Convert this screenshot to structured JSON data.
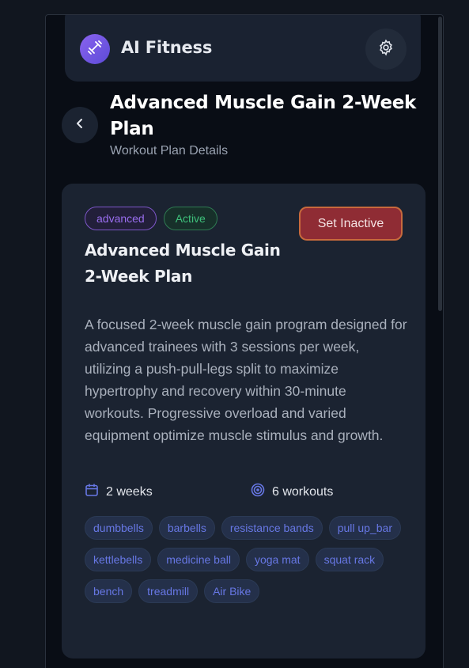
{
  "app": {
    "title": "AI Fitness"
  },
  "header": {
    "title": "Advanced Muscle Gain 2-Week Plan",
    "subtitle": "Workout Plan Details"
  },
  "plan": {
    "level_badge": "advanced",
    "status_badge": "Active",
    "toggle_button_label": "Set Inactive",
    "title": "Advanced Muscle Gain 2-Week Plan",
    "description": "A focused 2-week muscle gain program designed for advanced trainees with 3 sessions per week, utilizing a push-pull-legs split to maximize hypertrophy and recovery within 30-minute workouts. Progressive overload and varied equipment optimize muscle stimulus and growth.",
    "duration": "2 weeks",
    "workouts": "6 workouts",
    "equipment": [
      "dumbbells",
      "barbells",
      "resistance bands",
      "pull up_bar",
      "kettlebells",
      "medicine ball",
      "yoga mat",
      "squat rack",
      "bench",
      "treadmill",
      "Air Bike"
    ]
  },
  "icons": {
    "logo": "dumbbell-icon",
    "settings": "gear-icon",
    "back": "chevron-left-icon",
    "duration": "calendar-icon",
    "workouts": "target-icon"
  },
  "colors": {
    "accent": "#6777e4",
    "danger": "#8f2c34",
    "success": "#3ec07a",
    "level": "#9a6ef0"
  }
}
